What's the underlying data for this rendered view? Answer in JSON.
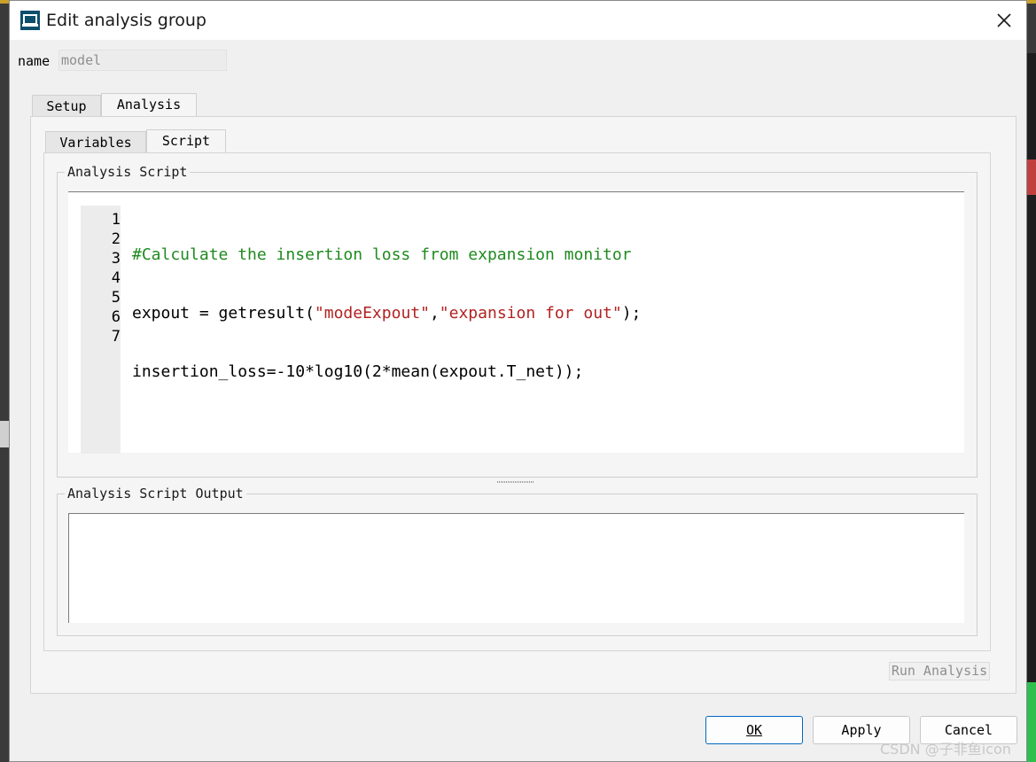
{
  "dialog": {
    "title": "Edit analysis group",
    "close_glyph": "✕",
    "accent_color": "#0067c0"
  },
  "name_field": {
    "label": "name",
    "value": "model"
  },
  "outer_tabs": [
    {
      "label": "Setup",
      "active": false
    },
    {
      "label": "Analysis",
      "active": true
    }
  ],
  "inner_tabs": [
    {
      "label": "Variables",
      "active": false
    },
    {
      "label": "Script",
      "active": true
    }
  ],
  "script_group": {
    "title": "Analysis Script",
    "line_numbers": [
      "1",
      "2",
      "3",
      "4",
      "5",
      "6",
      "7"
    ],
    "lines": {
      "l1": "#Calculate the insertion loss from expansion monitor",
      "l2_a": "expout = getresult(",
      "l2_s1": "\"modeExpout\"",
      "l2_b": ",",
      "l2_s2": "\"expansion for out\"",
      "l2_c": ");",
      "l3": "insertion_loss=-10*log10(2*mean(expout.T_net));"
    }
  },
  "output_group": {
    "title": "Analysis Script Output",
    "content": ""
  },
  "buttons": {
    "run_analysis": "Run Analysis",
    "ok": "OK",
    "apply": "Apply",
    "cancel": "Cancel"
  },
  "watermark": "CSDN @子非鱼icon"
}
